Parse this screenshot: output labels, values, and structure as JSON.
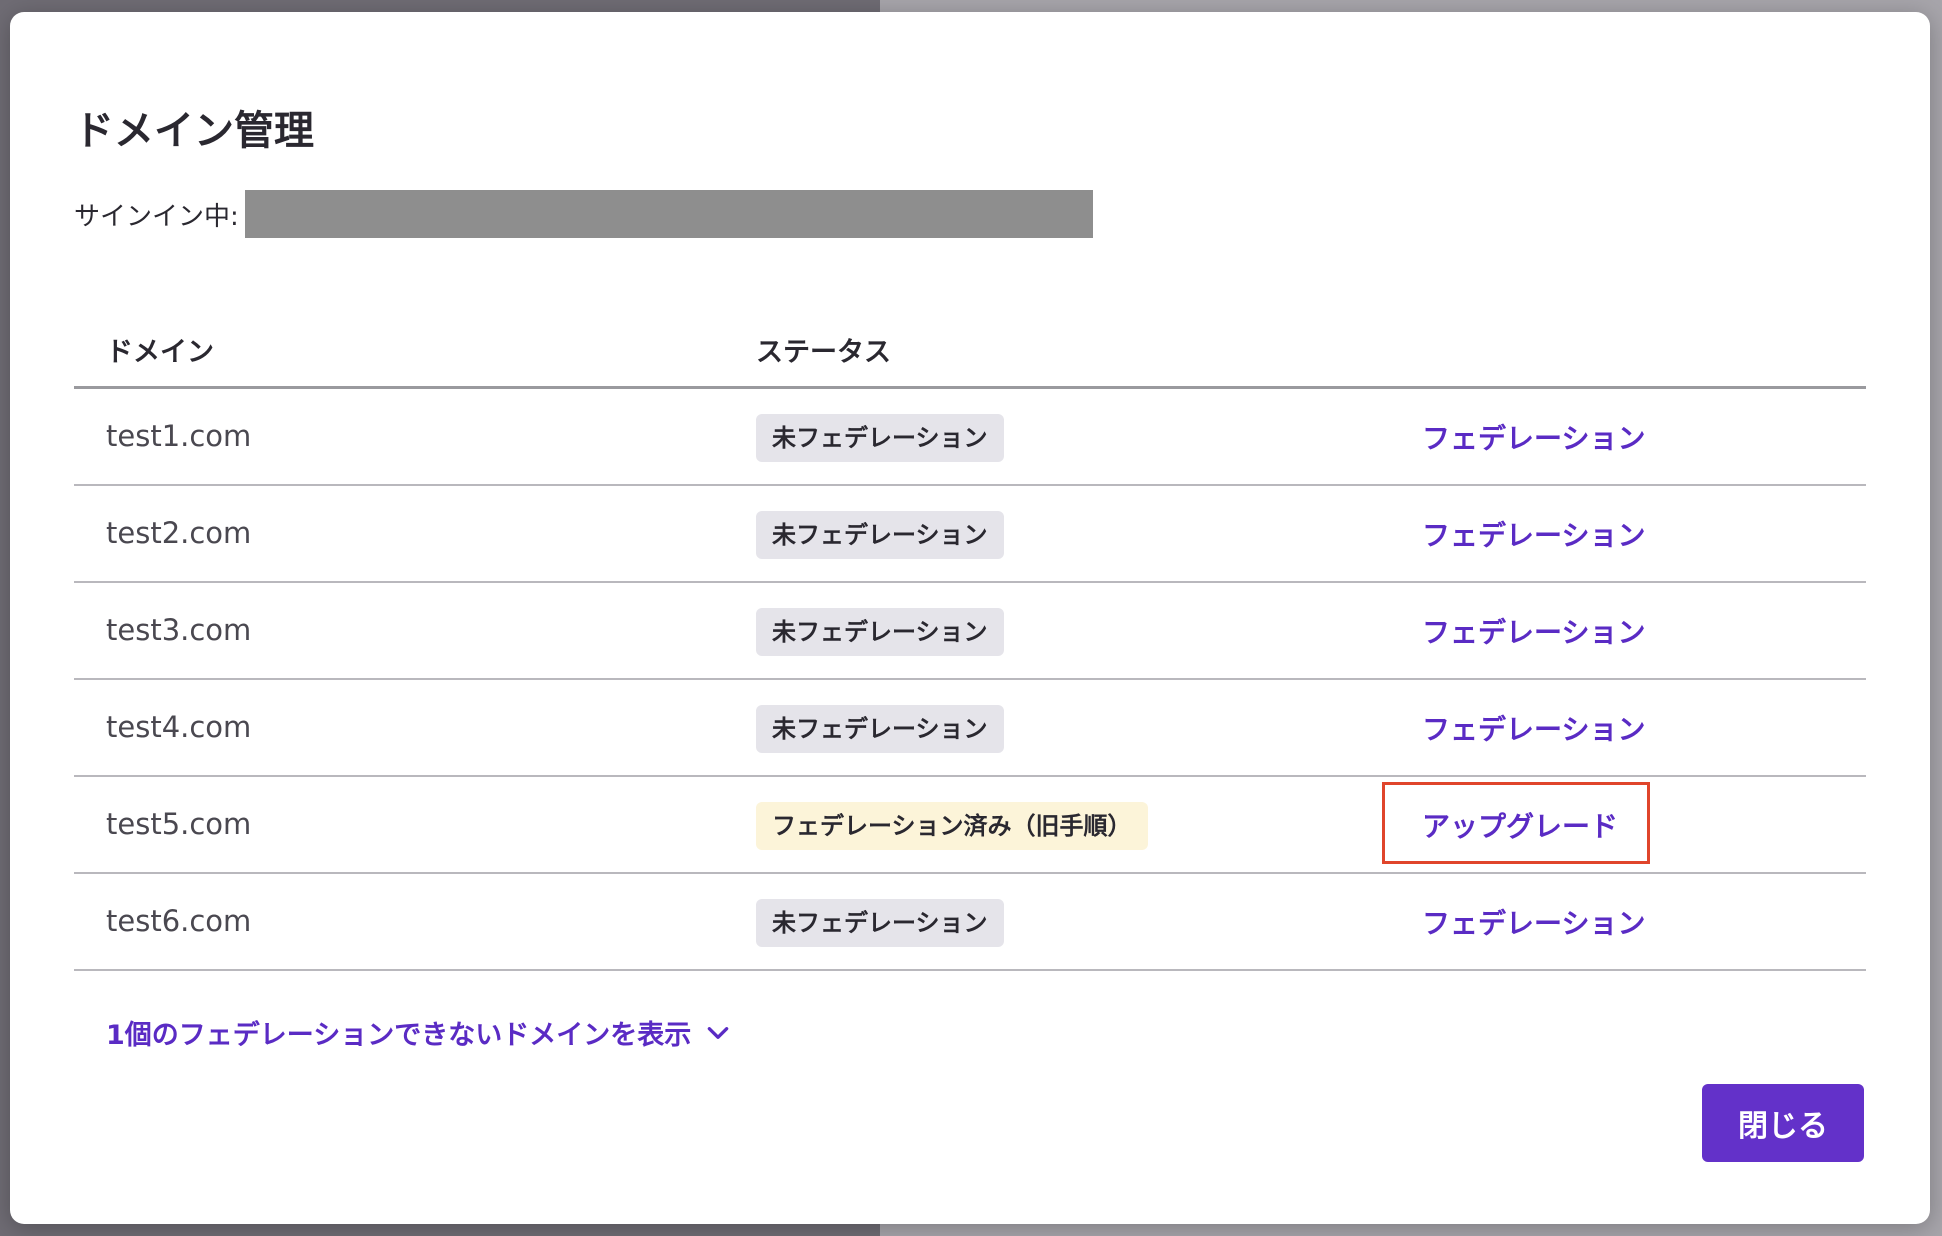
{
  "dialog": {
    "title": "ドメイン管理",
    "signin_label": "サインイン中:"
  },
  "table": {
    "headers": {
      "domain": "ドメイン",
      "status": "ステータス"
    },
    "rows": [
      {
        "domain": "test1.com",
        "status": "未フェデレーション",
        "action": "フェデレーション"
      },
      {
        "domain": "test2.com",
        "status": "未フェデレーション",
        "action": "フェデレーション"
      },
      {
        "domain": "test3.com",
        "status": "未フェデレーション",
        "action": "フェデレーション"
      },
      {
        "domain": "test4.com",
        "status": "未フェデレーション",
        "action": "フェデレーション"
      },
      {
        "domain": "test5.com",
        "status": "フェデレーション済み（旧手順）",
        "action": "アップグレード"
      },
      {
        "domain": "test6.com",
        "status": "未フェデレーション",
        "action": "フェデレーション"
      }
    ]
  },
  "show_more": {
    "label": "1個のフェデレーションできないドメインを表示"
  },
  "footer": {
    "close_label": "閉じる"
  },
  "colors": {
    "accent": "#5a2bc4",
    "primary_button": "#6331c9",
    "badge_default": "#e5e4ea",
    "badge_federated": "#fcf4d9",
    "highlight": "#e0452b"
  },
  "icons": {
    "show_more": "chevron-down-icon"
  }
}
